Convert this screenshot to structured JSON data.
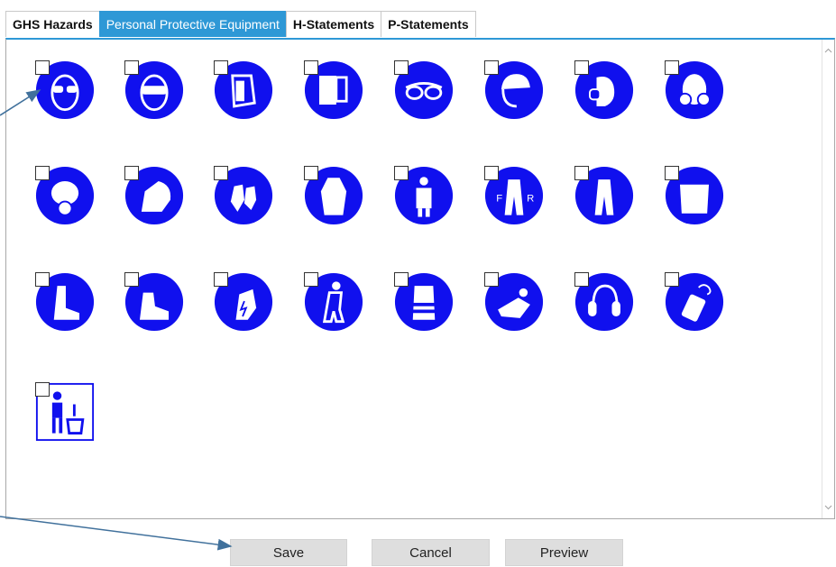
{
  "tabs": [
    {
      "label": "GHS Hazards",
      "active": false
    },
    {
      "label": "Personal Protective Equipment",
      "active": true
    },
    {
      "label": "H-Statements",
      "active": false
    },
    {
      "label": "P-Statements",
      "active": false
    }
  ],
  "ppe_icons": [
    {
      "name": "safety-glasses-icon",
      "checked": false
    },
    {
      "name": "goggles-icon",
      "checked": false
    },
    {
      "name": "face-shield-icon",
      "checked": false
    },
    {
      "name": "welding-shield-icon",
      "checked": false
    },
    {
      "name": "eye-goggles-icon",
      "checked": false
    },
    {
      "name": "hard-hat-icon",
      "checked": false
    },
    {
      "name": "dust-mask-icon",
      "checked": false
    },
    {
      "name": "respirator-icon",
      "checked": false
    },
    {
      "name": "full-face-respirator-icon",
      "checked": false
    },
    {
      "name": "hood-icon",
      "checked": false
    },
    {
      "name": "gloves-icon",
      "checked": false
    },
    {
      "name": "lab-coat-icon",
      "checked": false
    },
    {
      "name": "apron-icon",
      "checked": false
    },
    {
      "name": "fr-coveralls-icon",
      "checked": false
    },
    {
      "name": "coveralls-icon",
      "checked": false
    },
    {
      "name": "long-sleeves-icon",
      "checked": false
    },
    {
      "name": "rubber-boots-icon",
      "checked": false
    },
    {
      "name": "safety-shoes-icon",
      "checked": false
    },
    {
      "name": "antistatic-footwear-icon",
      "checked": false
    },
    {
      "name": "safety-harness-icon",
      "checked": false
    },
    {
      "name": "hi-vis-vest-icon",
      "checked": false
    },
    {
      "name": "hand-protection-icon",
      "checked": false
    },
    {
      "name": "ear-protection-icon",
      "checked": false
    },
    {
      "name": "barrier-cream-icon",
      "checked": false
    },
    {
      "name": "dispose-waste-icon",
      "checked": false
    }
  ],
  "buttons": {
    "save": "Save",
    "cancel": "Cancel",
    "preview": "Preview"
  },
  "colors": {
    "tab_active": "#2e98d6",
    "icon_blue": "#1010ee",
    "arrow": "#41719c"
  }
}
